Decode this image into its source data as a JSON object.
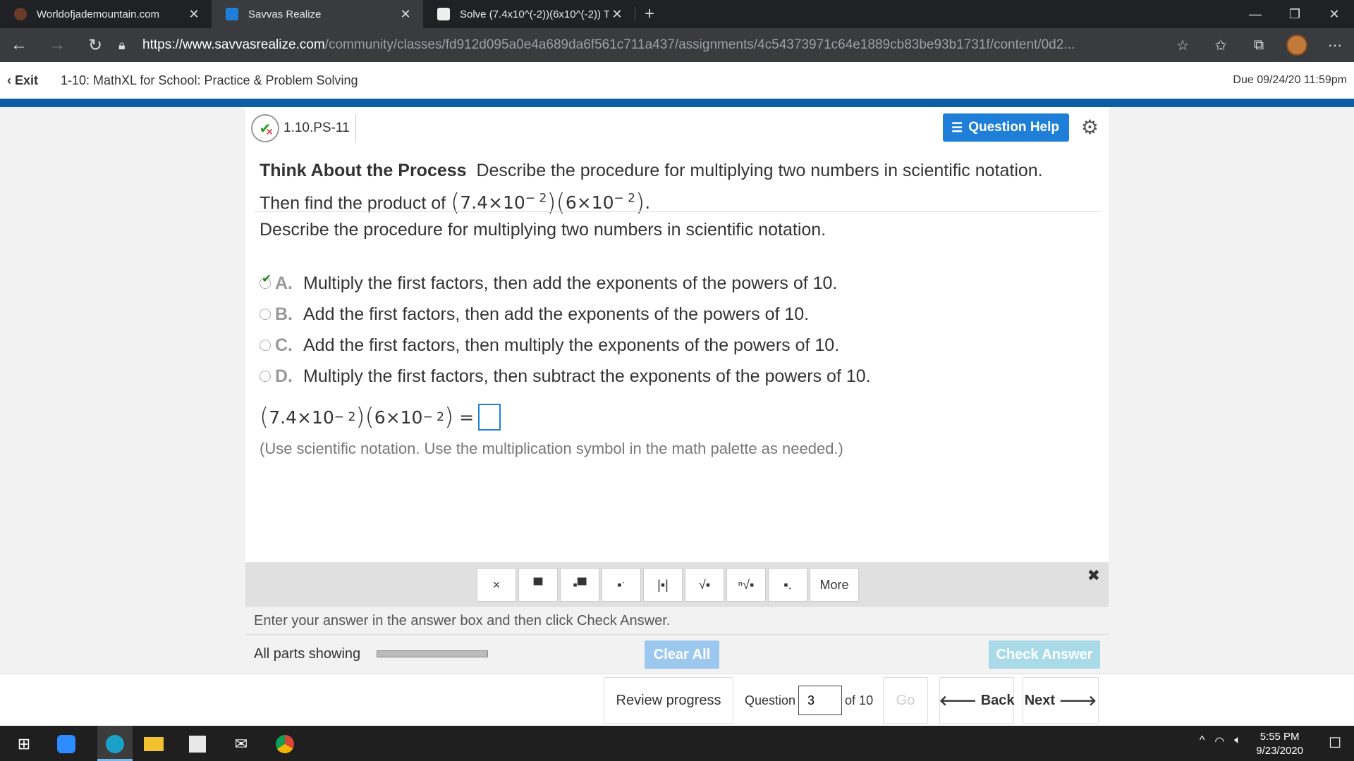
{
  "browser": {
    "tabs": [
      {
        "title": "Worldofjademountain.com",
        "active": false
      },
      {
        "title": "Savvas Realize",
        "active": true
      },
      {
        "title": "Solve (7.4x10^(-2))(6x10^(-2)) Ti",
        "active": false
      }
    ],
    "url_host": "https://www.savvasrealize.com",
    "url_path": "/community/classes/fd912d095a0e4a689da6f561c711a437/assignments/4c54373971c64e1889cb83be93b1731f/content/0d2..."
  },
  "app_header": {
    "exit_label": "Exit",
    "title": "1-10: MathXL for School: Practice & Problem Solving",
    "due": "Due 09/24/20 11:59pm"
  },
  "question": {
    "id": "1.10.PS-11",
    "help_label": "Question Help",
    "prompt_bold": "Think About the Process",
    "prompt_text": "Describe the procedure for multiplying two numbers in scientific notation.",
    "prompt_line2": "Then find the product of",
    "expr": {
      "a": "7.4",
      "b": "6",
      "base": "10",
      "exp": "− 2",
      "times": "×"
    },
    "subprompt": "Describe the procedure for multiplying two numbers in scientific notation.",
    "choices": [
      {
        "letter": "A.",
        "text": "Multiply the first factors, then add the exponents of the powers of 10.",
        "selected": true
      },
      {
        "letter": "B.",
        "text": "Add the first factors, then add the exponents of the powers of 10.",
        "selected": false
      },
      {
        "letter": "C.",
        "text": "Add the first factors, then multiply the exponents of the powers of 10.",
        "selected": false
      },
      {
        "letter": "D.",
        "text": "Multiply the first factors, then subtract the exponents of the powers of 10.",
        "selected": false
      }
    ],
    "equals": "=",
    "hint": "(Use scientific notation. Use the multiplication symbol in the math palette as needed.)"
  },
  "palette": {
    "tools": [
      "×",
      "fraction",
      "mixed-number",
      "exponent",
      "absolute-value",
      "square-root",
      "nth-root",
      "subscript"
    ],
    "more_label": "More"
  },
  "instructions": "Enter your answer in the answer box and then click Check Answer.",
  "parts": {
    "label": "All parts showing",
    "clear_label": "Clear All",
    "check_label": "Check Answer"
  },
  "footer": {
    "review_label": "Review progress",
    "question_label": "Question",
    "question_value": "3",
    "of_label": "of 10",
    "go_label": "Go",
    "back_label": "Back",
    "next_label": "Next"
  },
  "taskbar": {
    "time": "5:55 PM",
    "date": "9/23/2020"
  }
}
